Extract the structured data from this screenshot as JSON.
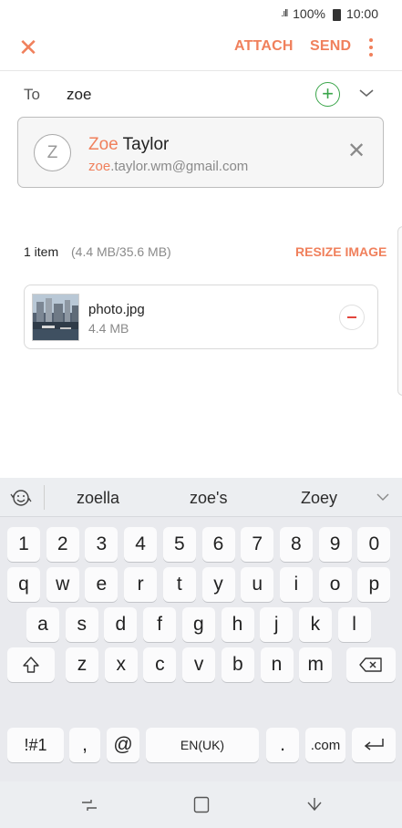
{
  "status_bar": {
    "signal": ".ıll",
    "battery": "100%",
    "time": "10:00"
  },
  "app_bar": {
    "attach_label": "ATTACH",
    "send_label": "SEND",
    "close_icon": "close-icon",
    "more_icon": "more-vert-icon"
  },
  "recipient": {
    "label": "To",
    "value": "zoe"
  },
  "suggestion": {
    "avatar_letter": "Z",
    "name_match": "Zoe",
    "name_rest": " Taylor",
    "email_match": "zoe",
    "email_rest": ".taylor.wm@gmail.com"
  },
  "attachments": {
    "count_label": "1 item",
    "size_label": "(4.4 MB/35.6 MB)",
    "resize_label": "RESIZE IMAGE",
    "file": {
      "name": "photo.jpg",
      "size": "4.4 MB"
    }
  },
  "keyboard": {
    "suggestions": [
      "zoella",
      "zoe's",
      "Zoey"
    ],
    "number_row": [
      "1",
      "2",
      "3",
      "4",
      "5",
      "6",
      "7",
      "8",
      "9",
      "0"
    ],
    "row1": [
      "q",
      "w",
      "e",
      "r",
      "t",
      "y",
      "u",
      "i",
      "o",
      "p"
    ],
    "row2": [
      "a",
      "s",
      "d",
      "f",
      "g",
      "h",
      "j",
      "k",
      "l"
    ],
    "row3": [
      "z",
      "x",
      "c",
      "v",
      "b",
      "n",
      "m"
    ],
    "symbols_key": "!#1",
    "comma_key": ",",
    "at_key": "@",
    "space_key": "EN(UK)",
    "period_key": ".",
    "com_key": ".com"
  },
  "colors": {
    "accent": "#f0805c",
    "add_green": "#3aa54a",
    "remove_red": "#e2453c"
  }
}
